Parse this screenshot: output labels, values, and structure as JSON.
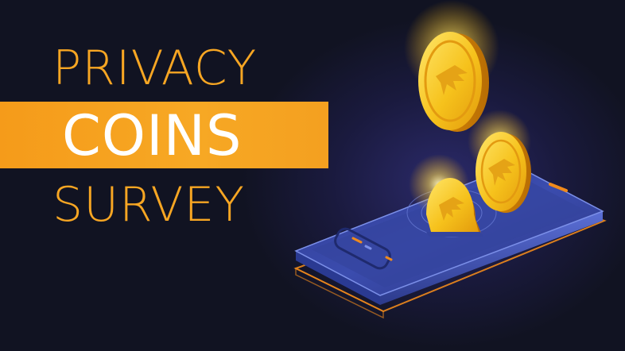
{
  "title": {
    "line1": "PRIVACY",
    "line2": "COINS",
    "line3": "SURVEY"
  },
  "colors": {
    "background": "#111322",
    "accent_orange": "#f7a623",
    "band": "#f59b1a",
    "coin_gold": "#f6c81f",
    "phone_blue": "#3d4fa8"
  },
  "icons": [
    "coin-icon",
    "phone-illustration"
  ]
}
